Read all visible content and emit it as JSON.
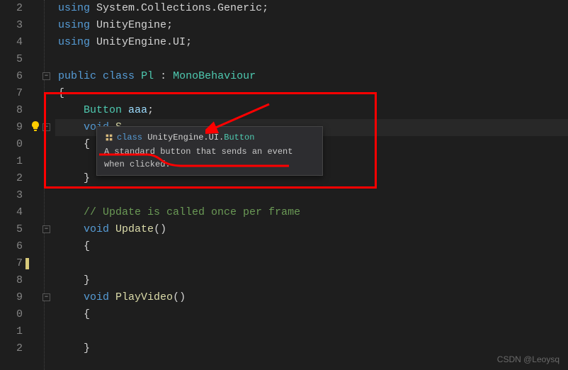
{
  "gutter": {
    "numbers": [
      "2",
      "3",
      "4",
      "5",
      "6",
      "7",
      "8",
      "9",
      "0",
      "1",
      "2",
      "3",
      "4",
      "5",
      "6",
      "7",
      "8",
      "9",
      "0",
      "1",
      "2"
    ]
  },
  "code": {
    "using": "using",
    "ns1": "System.Collections.Generic",
    "ns2": "UnityEngine",
    "ns3": "UnityEngine.UI",
    "public": "public",
    "class_kw": "class",
    "class_name": "Pl",
    "colon": ":",
    "base": "MonoBehaviour",
    "button_type": "Button",
    "button_var": "aaa",
    "void": "void",
    "start": "S",
    "update_comment": "// Update is called once per frame",
    "update": "Update",
    "playvideo": "PlayVideo",
    "paren": "()",
    "lbrace": "{",
    "rbrace": "}",
    "semi": ";"
  },
  "tooltip": {
    "class_kw": "class",
    "qualified": "UnityEngine.UI.",
    "type": "Button",
    "desc": "A standard button that sends an event when clicked."
  },
  "watermark": "CSDN @Leoysq",
  "icons": {
    "lightbulb": "lightbulb-icon",
    "fold_minus": "−",
    "class_icon": "class-icon"
  }
}
